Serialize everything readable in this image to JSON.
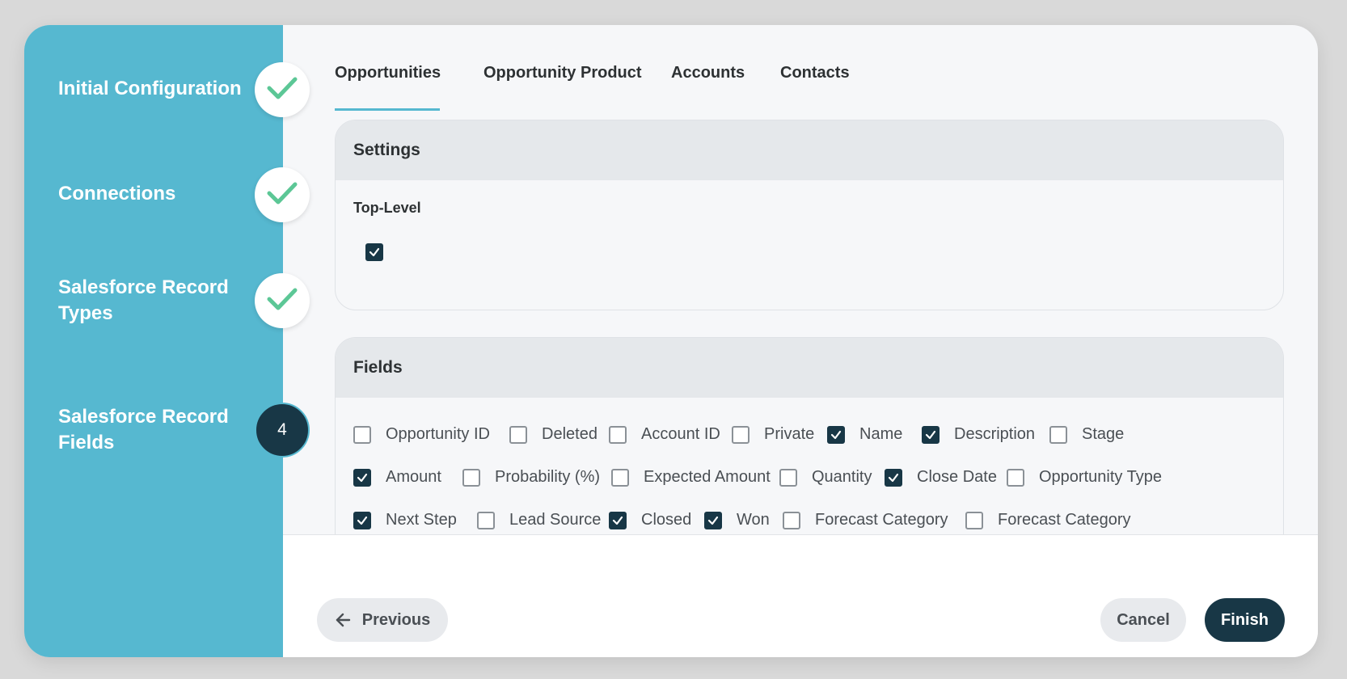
{
  "steps": [
    {
      "label": "Initial Configuration",
      "state": "done"
    },
    {
      "label": "Connections",
      "state": "done"
    },
    {
      "label": "Salesforce Record Types",
      "state": "done"
    },
    {
      "label": "Salesforce Record Fields",
      "state": "current",
      "number": "4"
    }
  ],
  "tabs": {
    "active": "Opportunities",
    "items": [
      "Opportunities",
      "Opportunity Product",
      "Accounts",
      "Contacts"
    ]
  },
  "settings": {
    "title": "Settings",
    "top_level_label": "Top-Level",
    "top_level_checked": true
  },
  "fields": {
    "title": "Fields",
    "items": [
      {
        "label": "Opportunity ID",
        "checked": false
      },
      {
        "label": "Deleted",
        "checked": false
      },
      {
        "label": "Account ID",
        "checked": false
      },
      {
        "label": "Private",
        "checked": false
      },
      {
        "label": "Name",
        "checked": true
      },
      {
        "label": "Description",
        "checked": true
      },
      {
        "label": "Stage",
        "checked": false
      },
      {
        "label": "Amount",
        "checked": true
      },
      {
        "label": "Probability (%)",
        "checked": false
      },
      {
        "label": "Expected Amount",
        "checked": false
      },
      {
        "label": "Quantity",
        "checked": false
      },
      {
        "label": "Close Date",
        "checked": true
      },
      {
        "label": "Opportunity Type",
        "checked": false
      },
      {
        "label": "Next Step",
        "checked": true
      },
      {
        "label": "Lead Source",
        "checked": false
      },
      {
        "label": "Closed",
        "checked": true
      },
      {
        "label": "Won",
        "checked": true
      },
      {
        "label": "Forecast Category",
        "checked": false
      },
      {
        "label": "Forecast Category",
        "checked": false
      }
    ]
  },
  "footer": {
    "previous_label": "Previous",
    "cancel_label": "Cancel",
    "finish_label": "Finish"
  },
  "colors": {
    "sidebar": "#56b8d0",
    "accent_dark": "#183746",
    "check_green": "#5cc796"
  },
  "icons": {
    "done": "check-icon",
    "previous": "arrow-left-icon"
  }
}
